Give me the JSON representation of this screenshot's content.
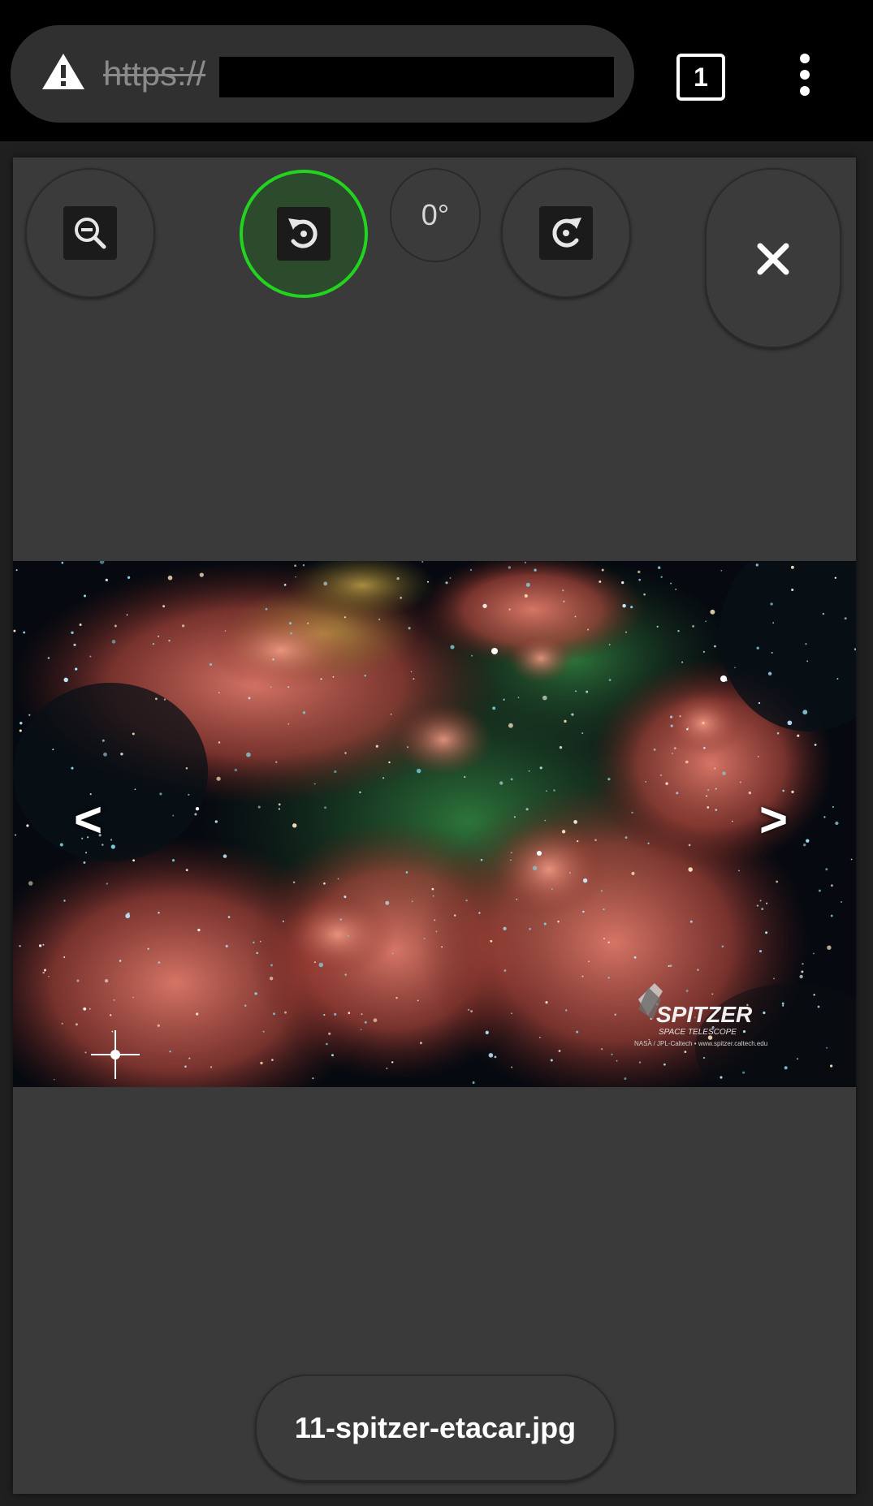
{
  "browser": {
    "url_scheme": "https://",
    "tab_count": "1",
    "icons": {
      "security": "warning-triangle-icon",
      "menu": "more-vert-icon"
    }
  },
  "viewer": {
    "rotation_label": "0°",
    "prev_label": "<",
    "next_label": ">",
    "filename": "11-spitzer-etacar.jpg",
    "image_logo_text": "SPITZER",
    "image_logo_subtext": "SPACE TELESCOPE",
    "image_credit": "NASA / JPL-Caltech • www.spitzer.caltech.edu",
    "accent_color": "#22d41f"
  }
}
